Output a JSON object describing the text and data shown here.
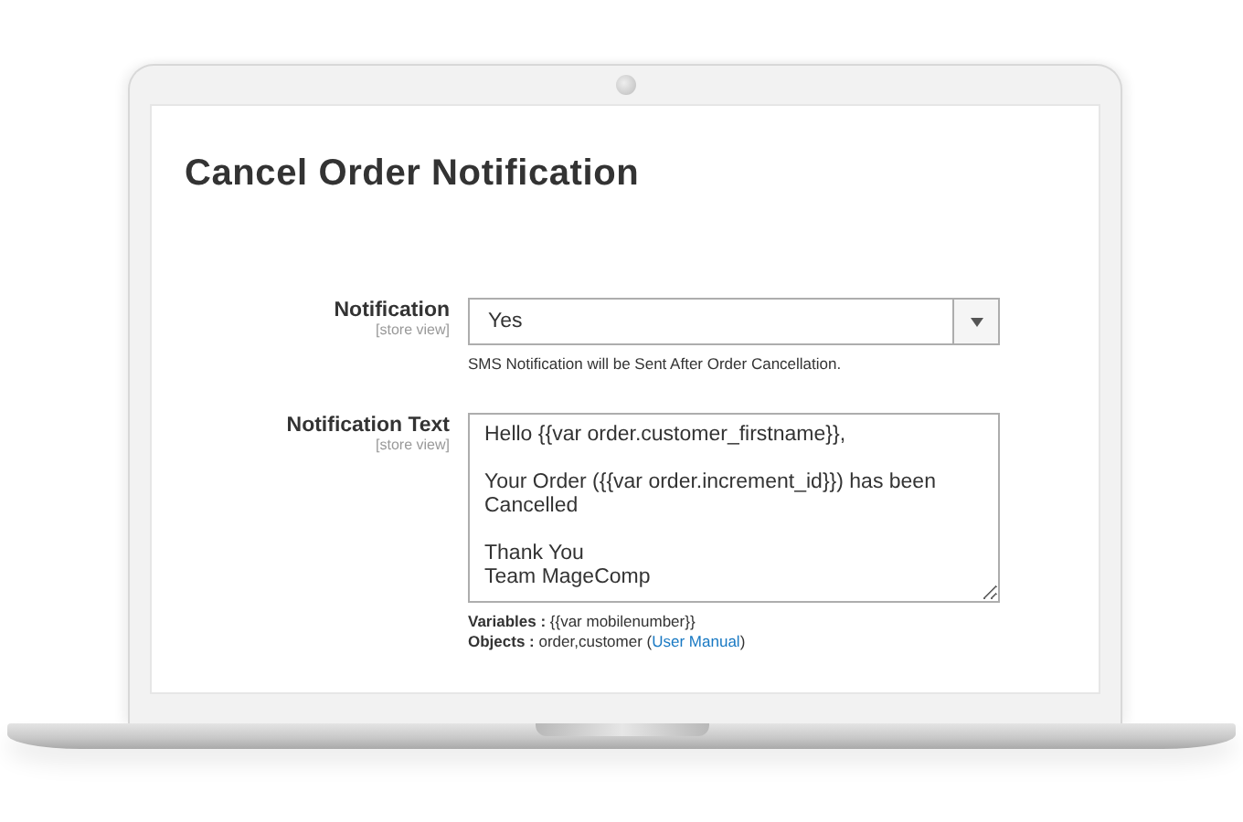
{
  "title": "Cancel Order Notification",
  "fields": [
    {
      "kind": "select",
      "label": "Notification",
      "scope": "[store view]",
      "value": "Yes",
      "notes": [
        {
          "text": "SMS Notification will be Sent After Order Cancellation."
        }
      ]
    },
    {
      "kind": "textarea",
      "label": "Notification Text",
      "scope": "[store view]",
      "value": "Hello {{var order.customer_firstname}},\n\nYour Order ({{var order.increment_id}}) has been Cancelled\n\nThank You\nTeam MageComp",
      "notes": [
        {
          "label": "Variables :",
          "text": " {{var mobilenumber}}"
        },
        {
          "label": "Objects :",
          "text": " order,customer (",
          "link": "User Manual",
          "after": ")"
        }
      ]
    }
  ]
}
